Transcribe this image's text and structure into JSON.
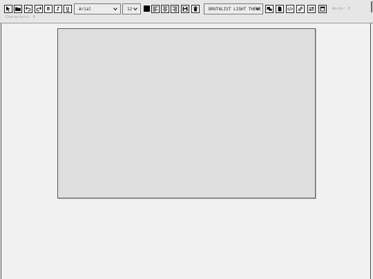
{
  "toolbar": {
    "font_select": "Arial",
    "size_select": "12",
    "theme_select": "BRUTALIST LIGHT THEME",
    "bold_label": "B",
    "italic_label": "I",
    "underline_label": "U",
    "text_color": "#000000"
  },
  "stats": {
    "words": "Words: 0",
    "characters": "Characters: 0"
  },
  "colors": {
    "toolbar_bg": "#e6e6e6",
    "canvas_bg": "#dedede",
    "page_bg": "#f1f1f1"
  }
}
